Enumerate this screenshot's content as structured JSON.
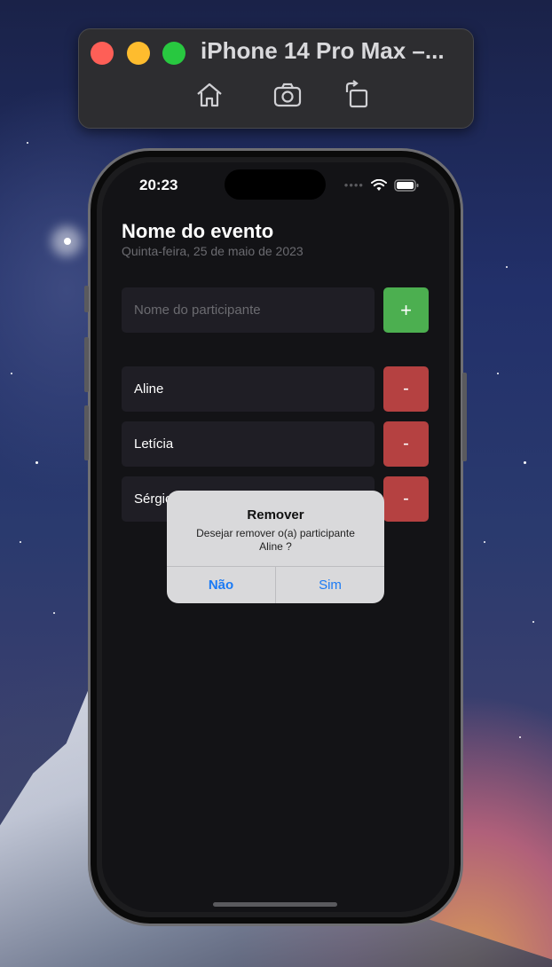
{
  "simulator": {
    "title": "iPhone 14 Pro Max –...",
    "toolbar_icons": [
      "home-icon",
      "screenshot-icon",
      "rotate-icon"
    ]
  },
  "status_bar": {
    "time": "20:23",
    "icons": [
      "signal-dots-icon",
      "wifi-icon",
      "battery-icon"
    ]
  },
  "event": {
    "title": "Nome do evento",
    "date": "Quinta-feira, 25 de maio de 2023"
  },
  "participant_input": {
    "placeholder": "Nome do participante",
    "value": ""
  },
  "add_button": {
    "label": "+"
  },
  "participants": [
    {
      "name": "Aline",
      "remove_label": "-"
    },
    {
      "name": "Letícia",
      "remove_label": "-"
    },
    {
      "name": "Sérgio",
      "remove_label": "-"
    }
  ],
  "alert": {
    "title": "Remover",
    "message": "Desejar remover o(a) participante Aline ?",
    "cancel_label": "Não",
    "confirm_label": "Sim"
  },
  "colors": {
    "add": "#4caf50",
    "remove": "#b54141",
    "alert_action": "#1a7af5"
  }
}
